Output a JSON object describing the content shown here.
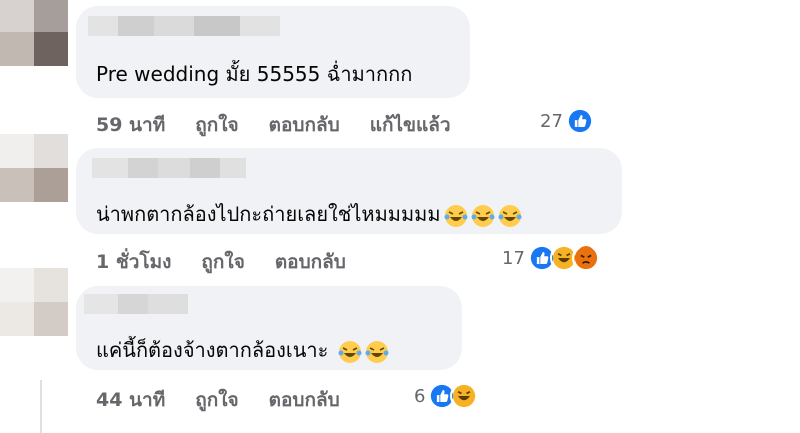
{
  "comments": [
    {
      "text": "Pre wedding มั้ย 55555 ฉ่ำมากกก",
      "time": "59 นาที",
      "like": "ถูกใจ",
      "reply": "ตอบกลับ",
      "edited": "แก้ไขแล้ว",
      "reaction_count": "27",
      "reactions": [
        "like-icon"
      ]
    },
    {
      "text": "น่าพกตากล้องไปกะถ่ายเลยใช่ไหมมมมม",
      "emojis": [
        "laughing-tears-emoji",
        "laughing-tears-emoji",
        "laughing-tears-emoji"
      ],
      "time": "1 ชั่วโมง",
      "like": "ถูกใจ",
      "reply": "ตอบกลับ",
      "reaction_count": "17",
      "reactions": [
        "like-icon",
        "haha-icon",
        "angry-icon"
      ]
    },
    {
      "text": "แค่นี้ก็ต้องจ้างตากล้องเนาะ",
      "emojis": [
        "laughing-tears-emoji",
        "laughing-tears-emoji"
      ],
      "time": "44 นาที",
      "like": "ถูกใจ",
      "reply": "ตอบกลับ",
      "reaction_count": "6",
      "reactions": [
        "like-icon",
        "haha-icon"
      ]
    }
  ],
  "colors": {
    "bubble": "#f0f2f5",
    "meta_text": "#65676b",
    "like_blue": "#1877f2",
    "haha_yellow": "#f7b125",
    "angry_red": "#e9710f"
  }
}
